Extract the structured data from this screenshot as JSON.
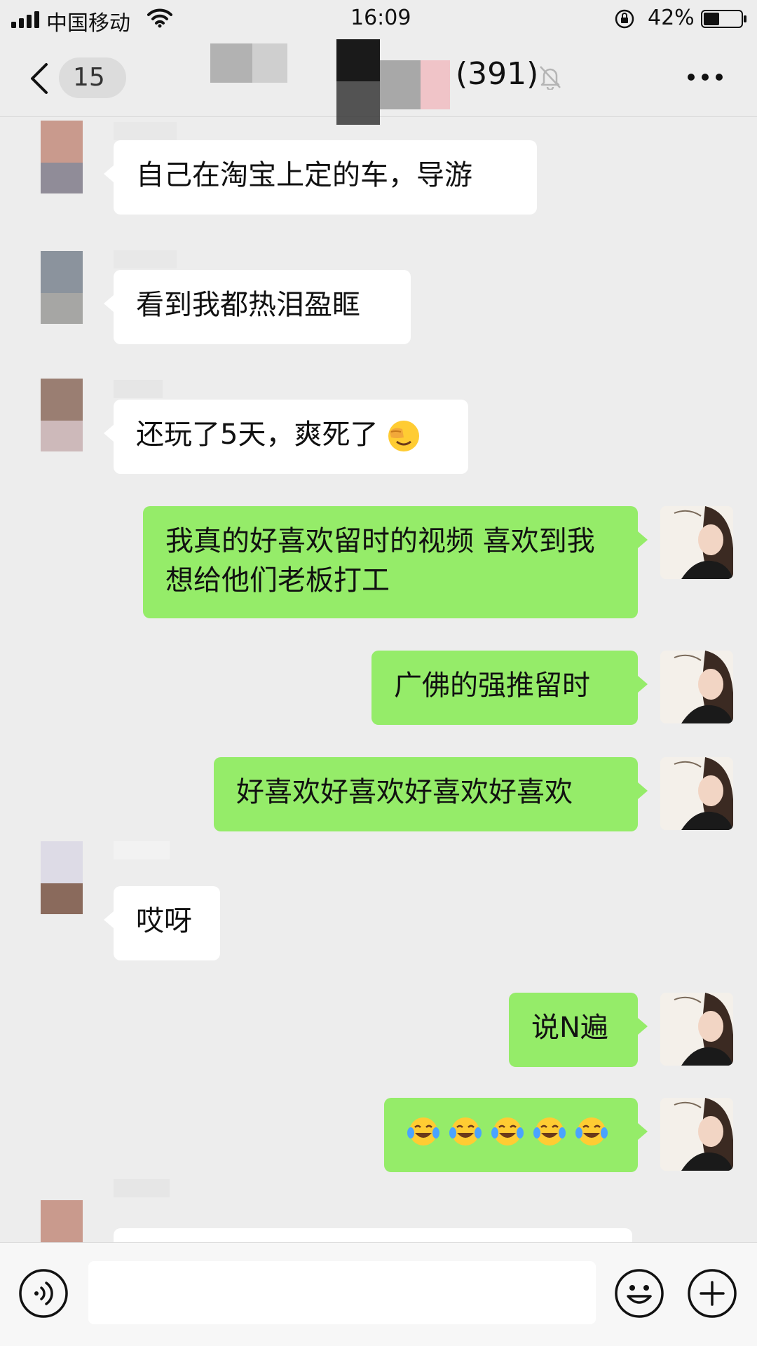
{
  "status_bar": {
    "carrier": "中国移动",
    "time": "16:09",
    "battery_percent": "42%"
  },
  "header": {
    "unread_count": "15",
    "member_count": "(391)"
  },
  "messages": [
    {
      "side": "left",
      "text": "自己在淘宝上定的车，导游"
    },
    {
      "side": "left",
      "text": "看到我都热泪盈眶"
    },
    {
      "side": "left",
      "text": "还玩了5天，爽死了"
    },
    {
      "side": "right",
      "text": "我真的好喜欢留时的视频 喜欢到我想给他们老板打工"
    },
    {
      "side": "right",
      "text": "广佛的强推留时"
    },
    {
      "side": "right",
      "text": "好喜欢好喜欢好喜欢好喜欢"
    },
    {
      "side": "left",
      "text": "哎呀"
    },
    {
      "side": "right",
      "text": "说N遍"
    },
    {
      "side": "right",
      "text": ""
    }
  ],
  "icons": {
    "facepalm_emoji": "face-palm-emoji",
    "laughing_emoji": "tears-of-joy-emoji"
  },
  "colors": {
    "background": "#ededed",
    "my_bubble": "#95ec69",
    "their_bubble": "#ffffff"
  }
}
